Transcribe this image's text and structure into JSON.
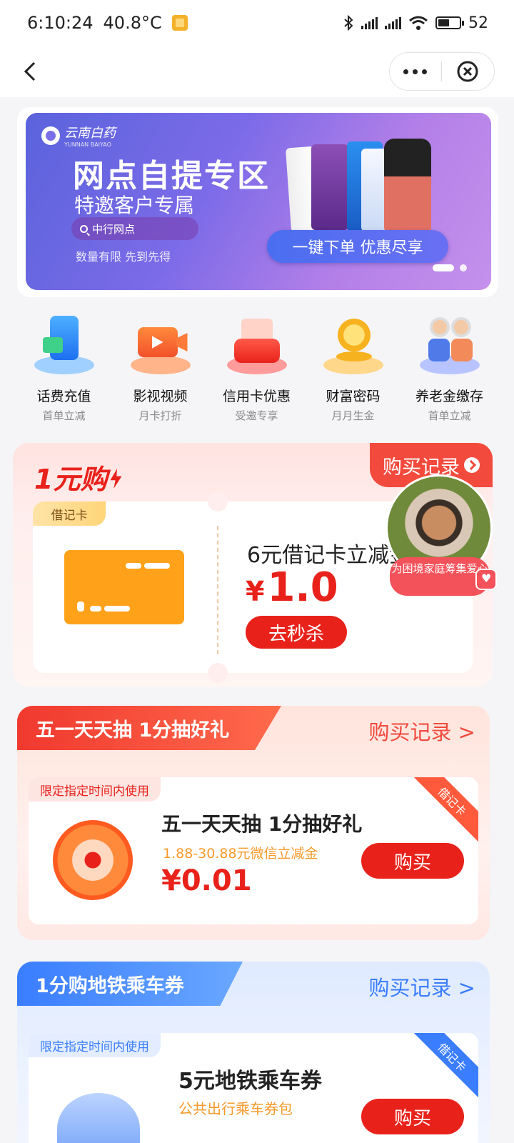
{
  "status_bar": {
    "time": "6:10:24",
    "temperature": "40.8°C",
    "battery": "52",
    "battery_level": 0.52
  },
  "banner": {
    "brand": "云南白药",
    "brand_en": "YUNNAN BAIYAO",
    "title": "网点自提专区",
    "subtitle": "特邀客户专属",
    "search_text": "中行网点",
    "note": "数量有限  先到先得",
    "cta": "一键下单  优惠尽享"
  },
  "services": [
    {
      "name": "话费充值",
      "sub": "首单立减",
      "icon": "phone-topup-icon"
    },
    {
      "name": "影视视频",
      "sub": "月卡打折",
      "icon": "video-camera-icon"
    },
    {
      "name": "信用卡优惠",
      "sub": "受邀专享",
      "icon": "red-envelope-icon"
    },
    {
      "name": "财富密码",
      "sub": "月月生金",
      "icon": "gold-coin-icon"
    },
    {
      "name": "养老金缴存",
      "sub": "首单立减",
      "icon": "elderly-couple-icon"
    }
  ],
  "one_yuan": {
    "title": "1元购",
    "record": "购买记录",
    "tag": "借记卡",
    "product": "6元借记卡立减金",
    "currency": "¥",
    "price": "1.0",
    "button": "去秒杀",
    "charity": "为困境家庭筹集爱心"
  },
  "raffle": {
    "title": "五一天天抽 1分抽好礼",
    "record": "购买记录 >",
    "time_tag": "限定指定时间内使用",
    "corner": "借记卡",
    "name": "五一天天抽 1分抽好礼",
    "sub": "1.88-30.88元微信立减金",
    "price": "¥0.01",
    "button": "购买"
  },
  "metro": {
    "title": "1分购地铁乘车券",
    "record": "购买记录 >",
    "time_tag": "限定指定时间内使用",
    "corner": "借记卡",
    "name": "5元地铁乘车券",
    "sub": "公共出行乘车券包",
    "button": "购买"
  }
}
